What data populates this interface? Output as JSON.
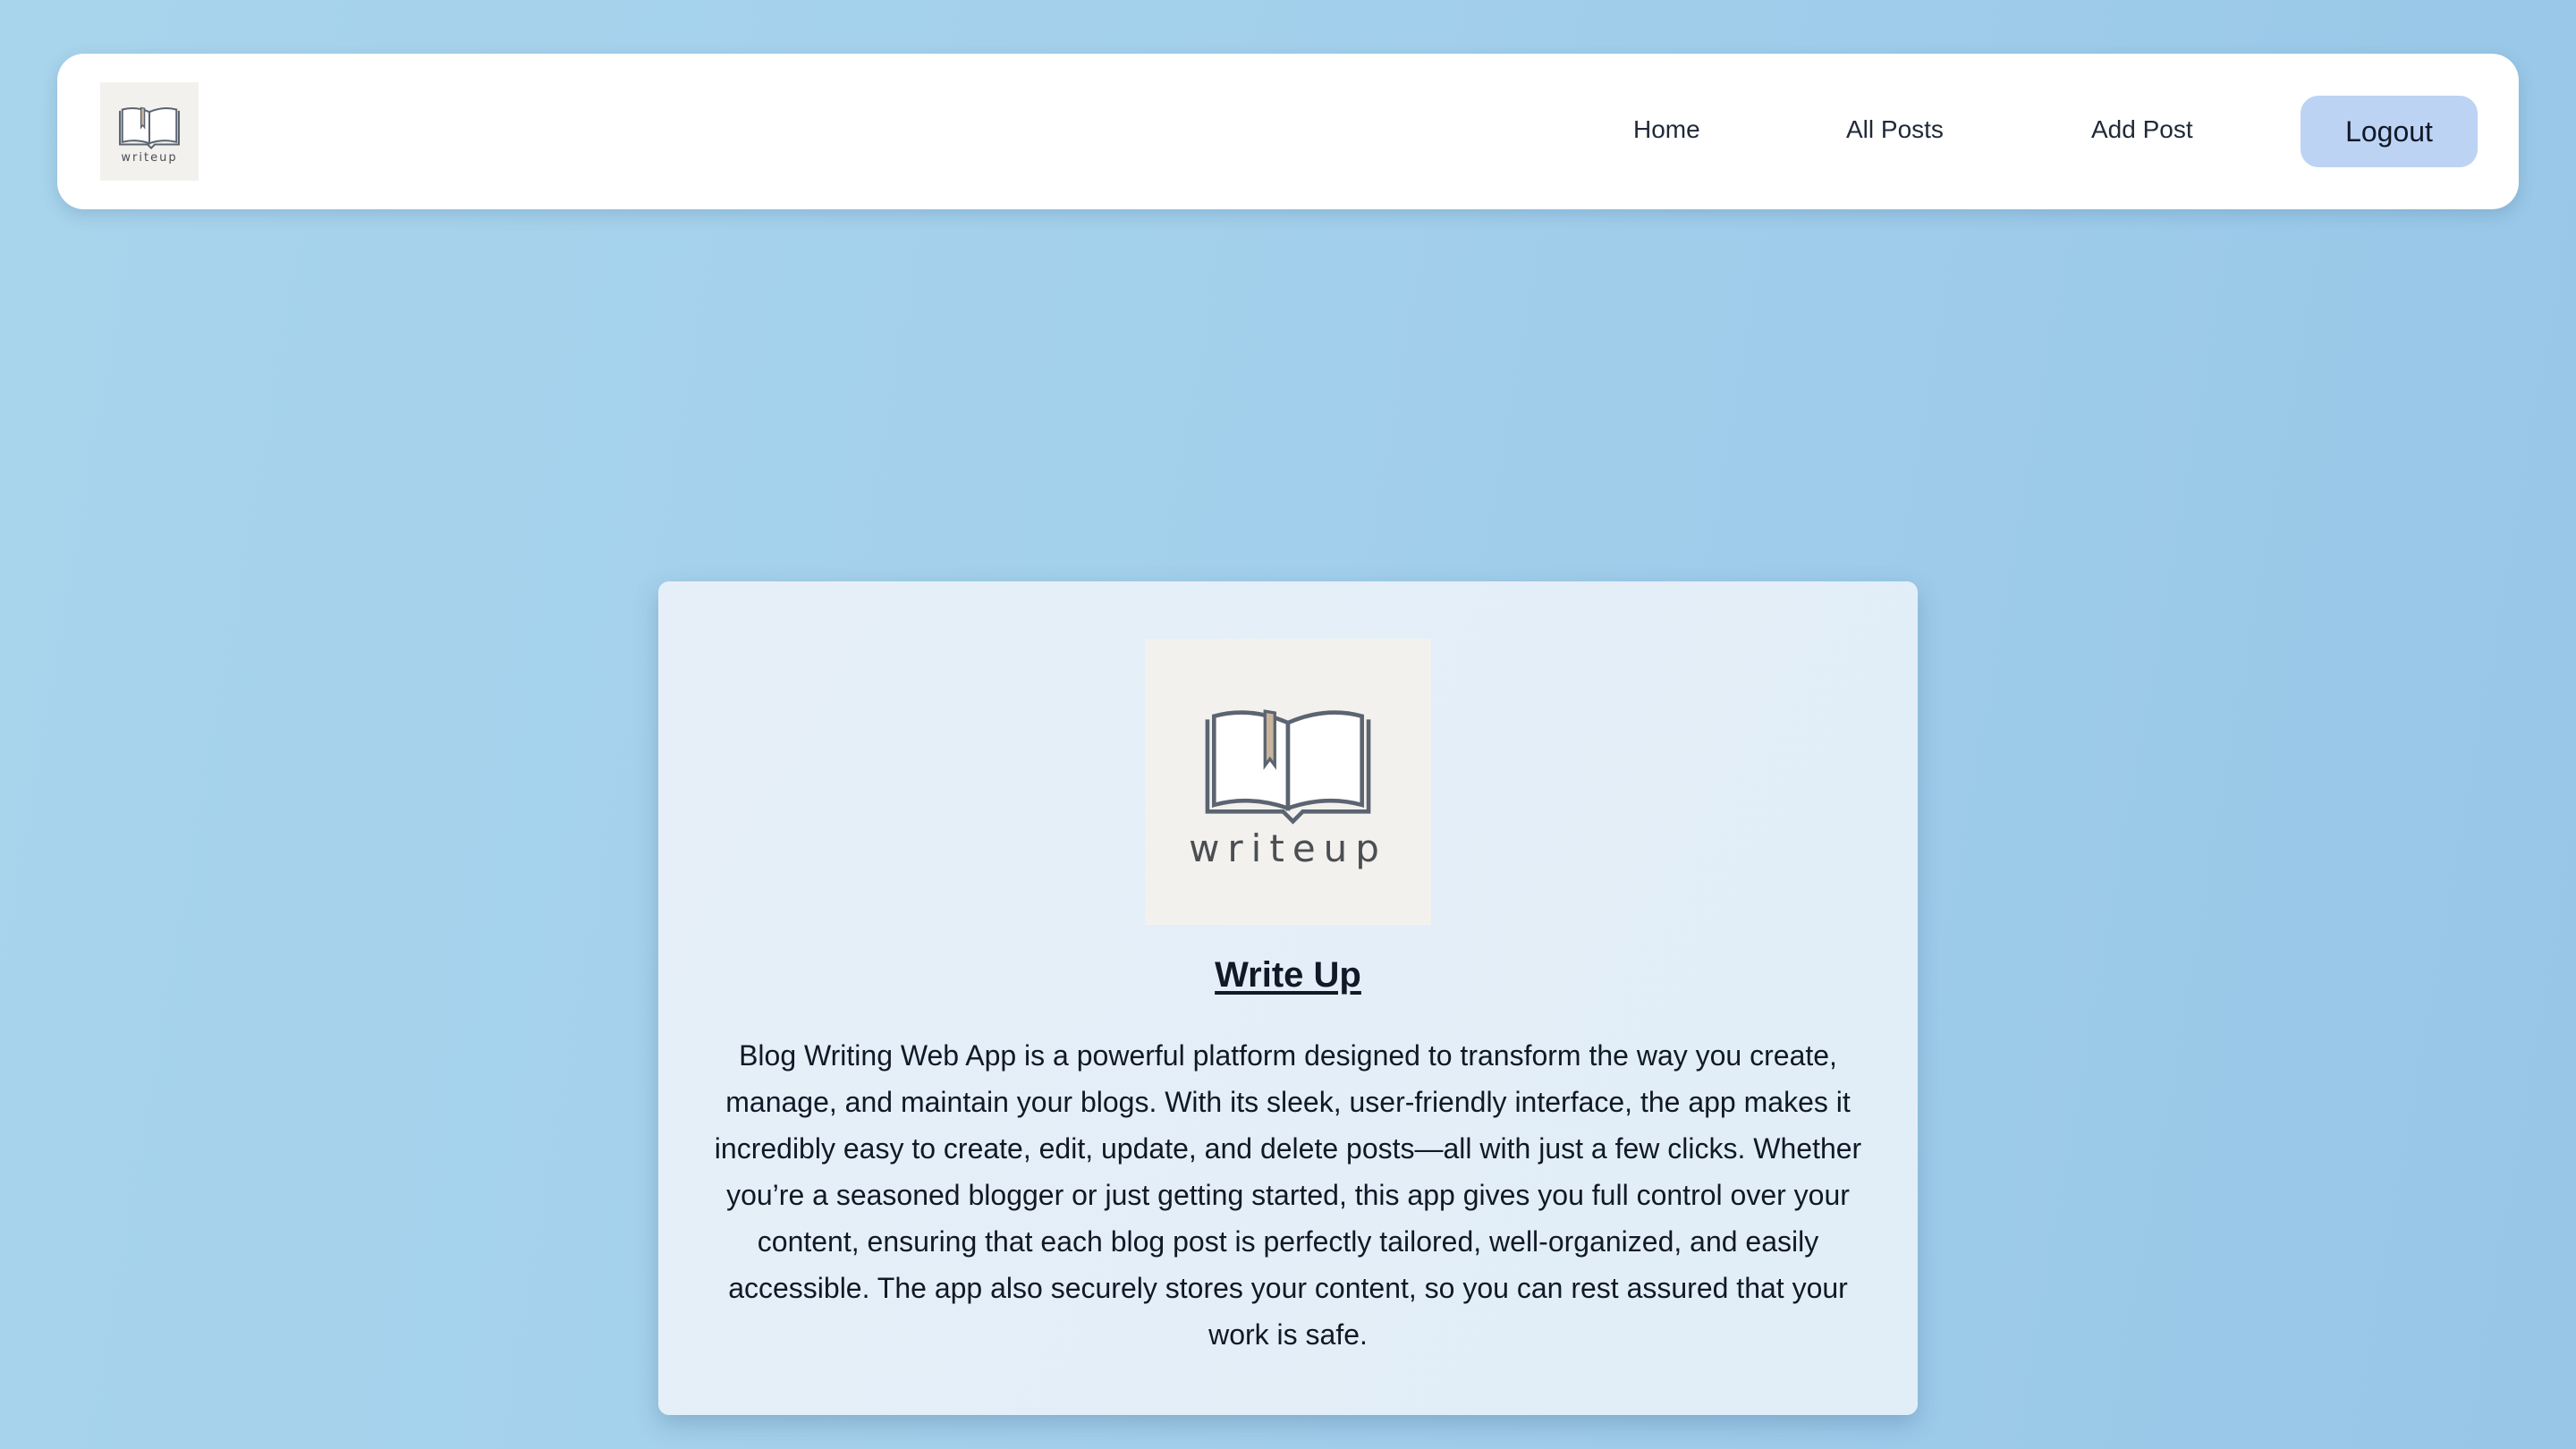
{
  "brand": {
    "logo_text": "writeup",
    "colors": {
      "page_background": "#a2cfeb",
      "navbar_background": "#ffffff",
      "logo_tile": "#f3f1ee",
      "bookmark": "#c7b49b",
      "button_background": "#bcd3f4",
      "card_background": "#e3eef8"
    }
  },
  "navbar": {
    "logo_icon": "open-book-icon",
    "links": {
      "home": "Home",
      "all_posts": "All Posts",
      "add_post": "Add Post"
    },
    "logout_label": "Logout"
  },
  "card": {
    "logo_icon": "open-book-icon",
    "logo_text": "writeup",
    "title": "Write Up",
    "description": "Blog Writing Web App is a powerful platform designed to transform the way you create, manage, and maintain your blogs. With its sleek, user-friendly interface, the app makes it incredibly easy to create, edit, update, and delete posts—all with just a few clicks. Whether you’re a seasoned blogger or just getting started, this app gives you full control over your content, ensuring that each blog post is perfectly tailored, well-organized, and easily accessible. The app also securely stores your content, so you can rest assured that your work is safe."
  }
}
